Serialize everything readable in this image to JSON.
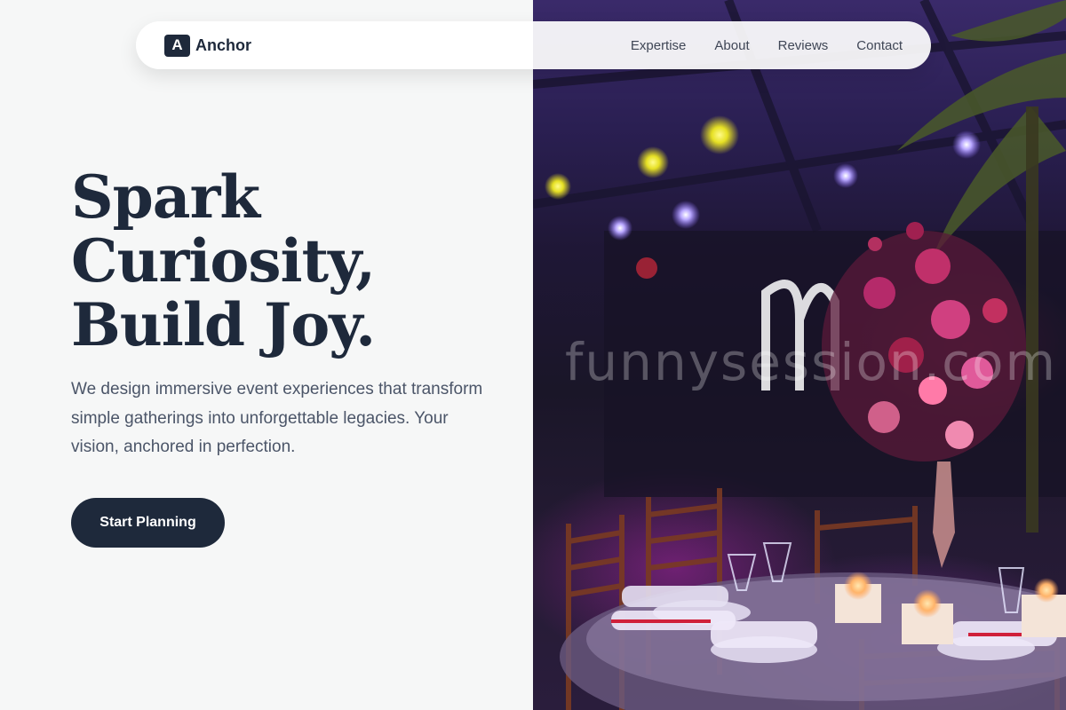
{
  "brand": {
    "mark": "A",
    "name": "Anchor"
  },
  "nav": {
    "links": [
      "Expertise",
      "About",
      "Reviews",
      "Contact"
    ]
  },
  "hero": {
    "title_lines": [
      "Spark",
      "Curiosity,",
      "Build Joy."
    ],
    "description": "We design immersive event experiences that transform simple gatherings into unforgettable legacies. Your vision, anchored in perfection.",
    "cta_label": "Start Planning"
  },
  "photo": {
    "watermark": "funnysession.com"
  },
  "colors": {
    "primary": "#1e293b",
    "background": "#f6f7f7",
    "text_muted": "#4b5568"
  }
}
